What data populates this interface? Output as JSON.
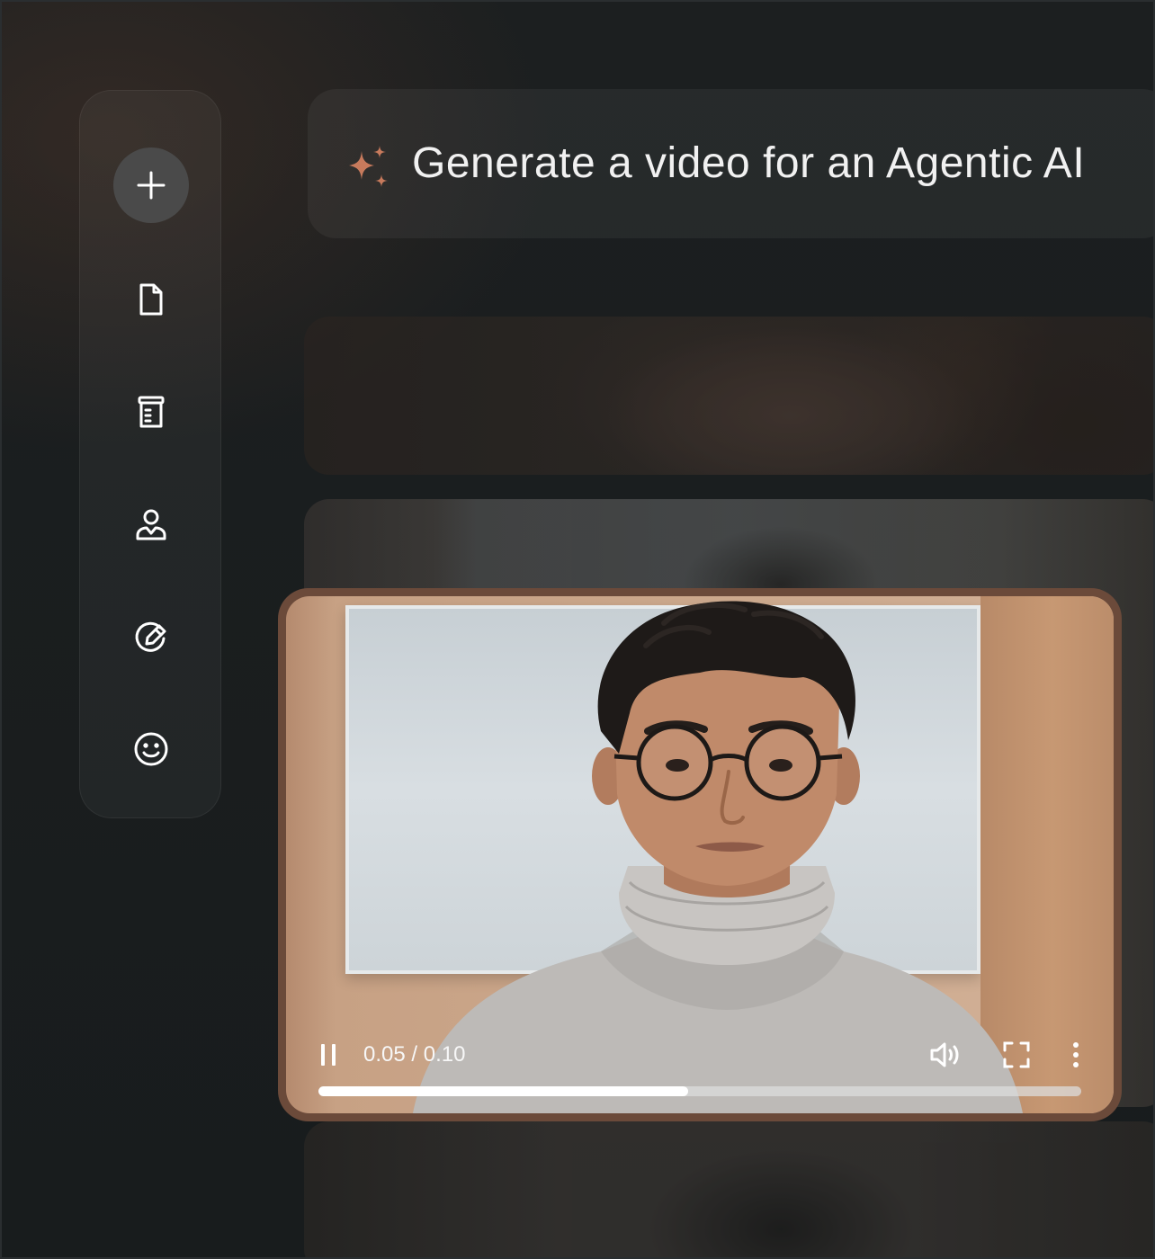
{
  "prompt": {
    "text": "Generate a video for an Agentic AI",
    "accent_color": "#c77a5c"
  },
  "sidebar": {
    "items": [
      {
        "name": "add",
        "icon": "plus-icon"
      },
      {
        "name": "document",
        "icon": "document-icon"
      },
      {
        "name": "script",
        "icon": "script-scroll-icon"
      },
      {
        "name": "avatar",
        "icon": "person-icon"
      },
      {
        "name": "edit",
        "icon": "edit-pencil-icon"
      },
      {
        "name": "emoji",
        "icon": "smiley-icon"
      }
    ]
  },
  "player": {
    "time": "0.05 / 0.10",
    "progress": 0.485,
    "frame_color": "#6b4a3a"
  }
}
